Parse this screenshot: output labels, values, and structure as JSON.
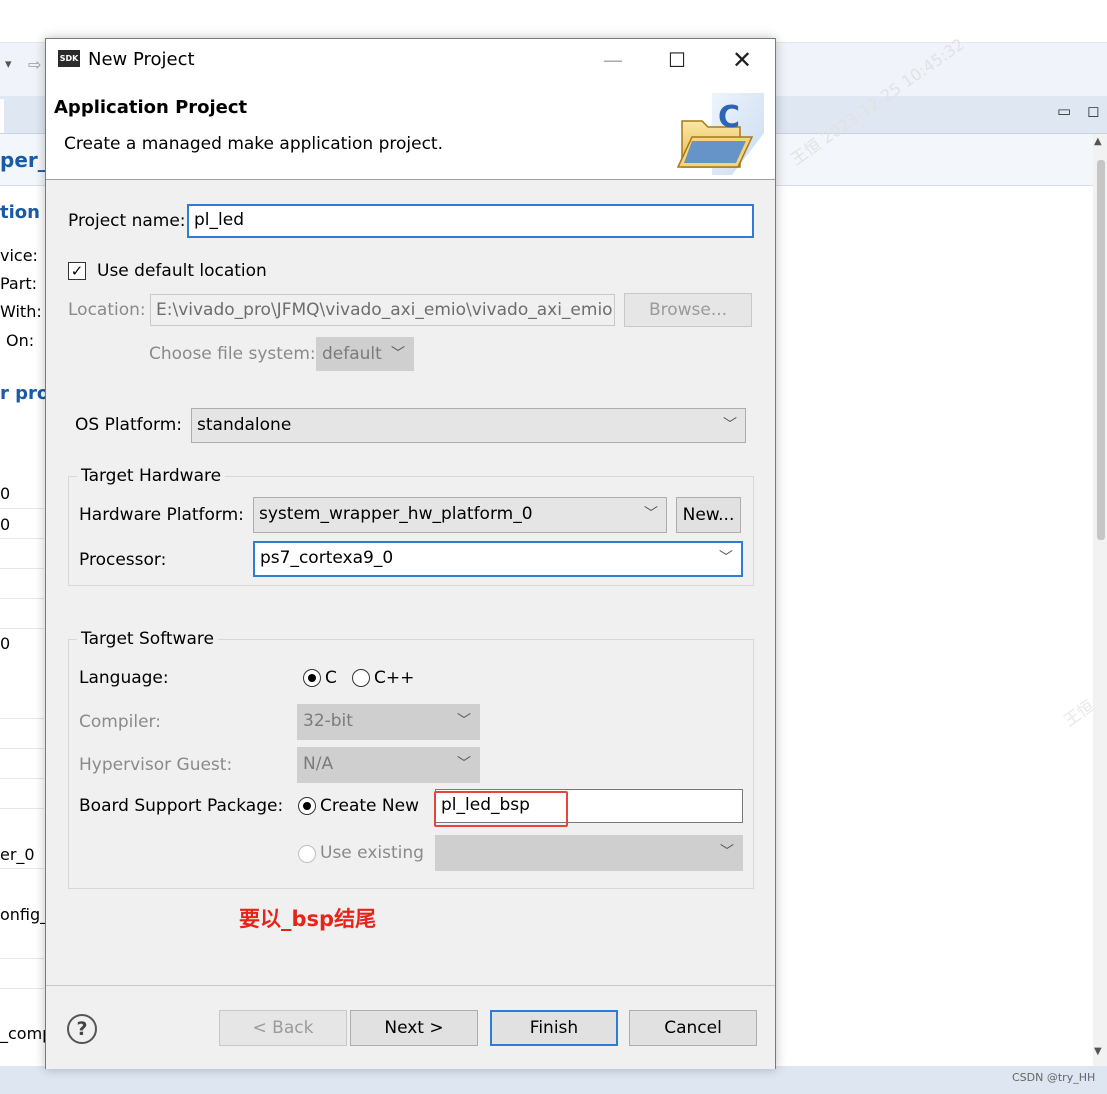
{
  "background": {
    "partial_texts": [
      "per_l",
      "tion",
      "vice:",
      "Part:",
      "With:",
      "On:",
      "r proc",
      "0",
      "0",
      "0",
      "er_0",
      "onfig_",
      "_comp"
    ],
    "watermark_text": "王恒 2023-12-25 10:45:32",
    "watermark_text_2": "王恒",
    "credit": "CSDN @try_HH"
  },
  "dialog": {
    "title": "New Project",
    "sdk_icon_label": "SDK",
    "window_controls": {
      "minimize": "—",
      "maximize": "☐",
      "close": "✕"
    },
    "banner": {
      "title": "Application Project",
      "description": "Create a managed make application project."
    },
    "project_name": {
      "label": "Project name:",
      "value": "pl_led"
    },
    "use_default_location": {
      "label": "Use default location",
      "checked": true
    },
    "location": {
      "label": "Location:",
      "value": "E:\\vivado_pro\\JFMQ\\vivado_axi_emio\\vivado_axi_emio.s",
      "browse_label": "Browse..."
    },
    "file_system": {
      "label": "Choose file system:",
      "value": "default"
    },
    "os_platform": {
      "label": "OS Platform:",
      "value": "standalone"
    },
    "target_hardware": {
      "title": "Target Hardware",
      "hardware_platform_label": "Hardware Platform:",
      "hardware_platform_value": "system_wrapper_hw_platform_0",
      "new_button": "New...",
      "processor_label": "Processor:",
      "processor_value": "ps7_cortexa9_0"
    },
    "target_software": {
      "title": "Target Software",
      "language_label": "Language:",
      "language_options": [
        "C",
        "C++"
      ],
      "language_selected": "C",
      "compiler_label": "Compiler:",
      "compiler_value": "32-bit",
      "hypervisor_label": "Hypervisor Guest:",
      "hypervisor_value": "N/A",
      "bsp_label": "Board Support Package:",
      "create_new_label": "Create New",
      "bsp_name": "pl_led_bsp",
      "use_existing_label": "Use existing"
    },
    "annotation": "要以_bsp结尾",
    "buttons": {
      "back": "< Back",
      "next": "Next >",
      "finish": "Finish",
      "cancel": "Cancel"
    },
    "colors": {
      "focus_border": "#2f7bd8",
      "annotation_red": "#e8241a",
      "background_blue": "#1a5aa6"
    }
  }
}
